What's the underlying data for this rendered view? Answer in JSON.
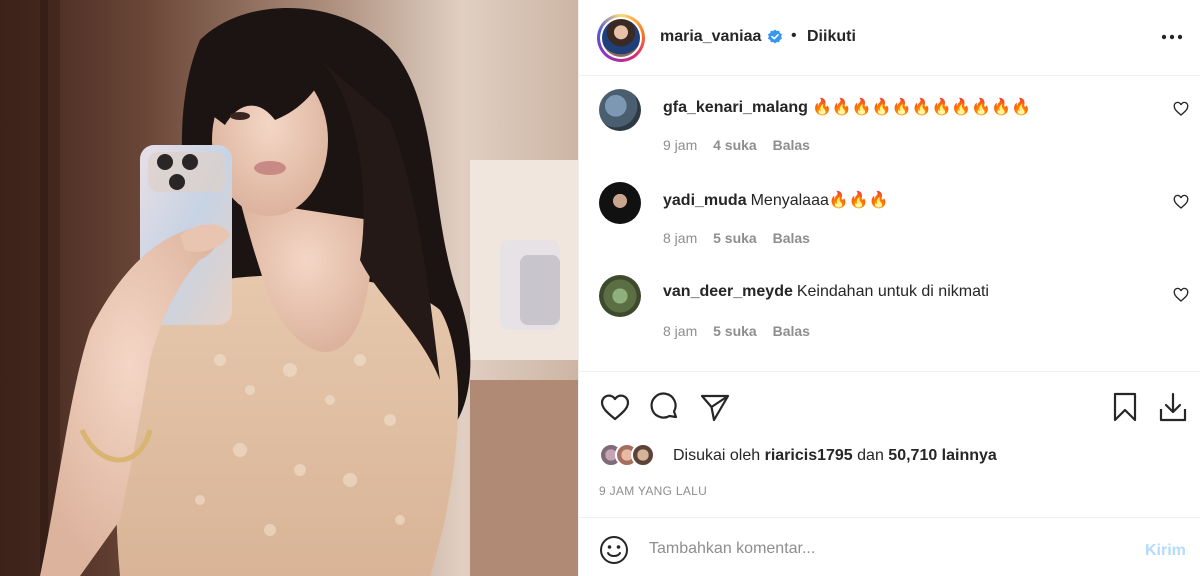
{
  "post": {
    "author": "maria_vaniaa",
    "separator": "•",
    "follow_status": "Diikuti",
    "more_icon": "more-horizontal-icon"
  },
  "comments": [
    {
      "username": "gfa_kenari_malang",
      "text": "🔥🔥🔥🔥🔥🔥🔥🔥🔥🔥🔥",
      "time": "9 jam",
      "likes": "4 suka",
      "reply": "Balas"
    },
    {
      "username": "yadi_muda",
      "text": "Menyalaaa🔥🔥🔥",
      "time": "8 jam",
      "likes": "5 suka",
      "reply": "Balas"
    },
    {
      "username": "van_deer_meyde",
      "text": "Keindahan untuk di nikmati",
      "time": "8 jam",
      "likes": "5 suka",
      "reply": "Balas"
    }
  ],
  "likes": {
    "prefix": "Disukai oleh",
    "user": "riaricis1795",
    "conjunction": "dan",
    "others": "50,710 lainnya"
  },
  "timestamp": "9 JAM YANG LALU",
  "composer": {
    "placeholder": "Tambahkan komentar...",
    "post_label": "Kirim"
  },
  "colors": {
    "verified": "#3897f0",
    "post_button_disabled": "#b3dbff",
    "meta_text": "#8e8e8e"
  }
}
